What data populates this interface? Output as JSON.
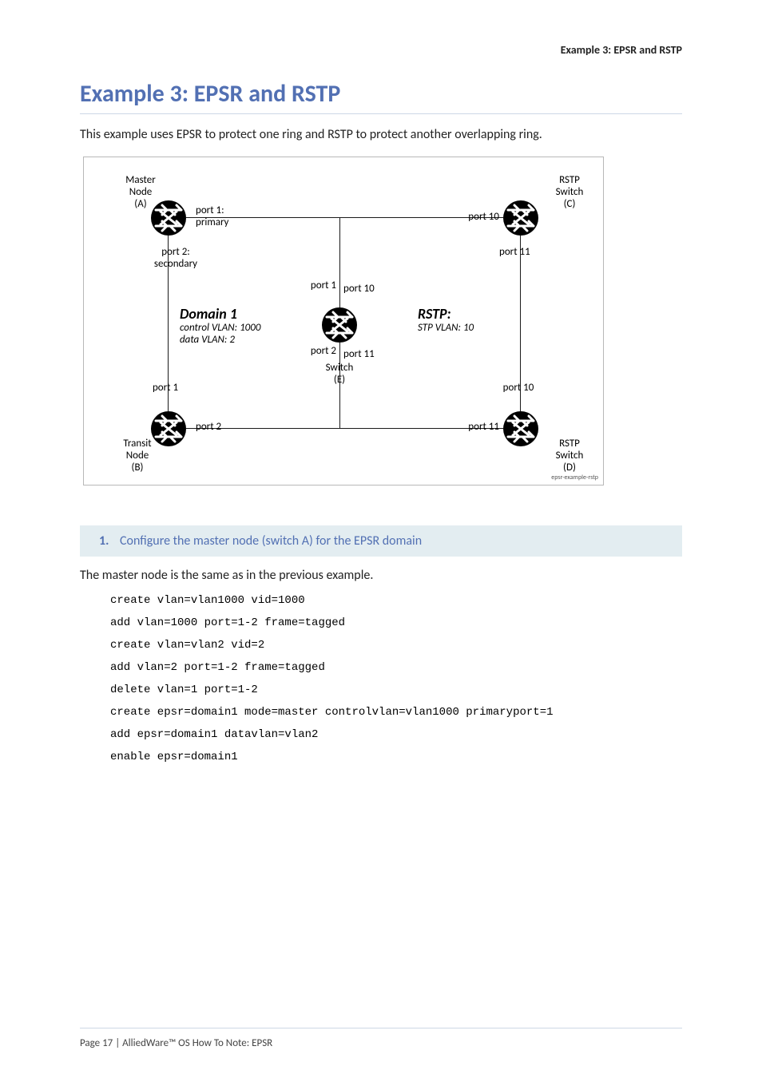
{
  "page_header": "Example 3: EPSR and RSTP",
  "title": "Example 3: EPSR and RSTP",
  "intro": "This example uses EPSR to protect one ring and RSTP to protect another overlapping ring.",
  "diagram": {
    "figure_id": "epsr-example-rstp",
    "nodes": {
      "A": {
        "name": "Master Node (A)",
        "role": "master",
        "port1_label": "port 1: primary",
        "port2_label": "port 2: secondary"
      },
      "B": {
        "name": "Transit Node (B)",
        "role": "transit",
        "port1_label": "port 1",
        "port2_label": "port 2"
      },
      "C": {
        "name": "RSTP Switch (C)",
        "port10_label": "port 10",
        "port11_label": "port 11"
      },
      "D": {
        "name": "RSTP Switch (D)",
        "port10_label": "port 10",
        "port11_label": "port 11"
      },
      "E": {
        "name": "Switch (E)",
        "left_top": "port 1",
        "left_bot": "port 2",
        "right_top": "port 10",
        "right_bot": "port 11"
      }
    },
    "domain1": {
      "title": "Domain 1",
      "control_vlan": "control VLAN: 1000",
      "data_vlan": "data VLAN: 2"
    },
    "rstp": {
      "title": "RSTP:",
      "stp_vlan": "STP VLAN: 10"
    }
  },
  "step": {
    "number": "1.",
    "text": "Configure the master node (switch A) for the EPSR domain"
  },
  "body_p": "The master node is the same as in the previous example.",
  "code": "create vlan=vlan1000 vid=1000\nadd vlan=1000 port=1-2 frame=tagged\ncreate vlan=vlan2 vid=2\nadd vlan=2 port=1-2 frame=tagged\ndelete vlan=1 port=1-2\ncreate epsr=domain1 mode=master controlvlan=vlan1000 primaryport=1\nadd epsr=domain1 datavlan=vlan2\nenable epsr=domain1",
  "footer": "Page 17 | AlliedWare™ OS How To Note: EPSR"
}
